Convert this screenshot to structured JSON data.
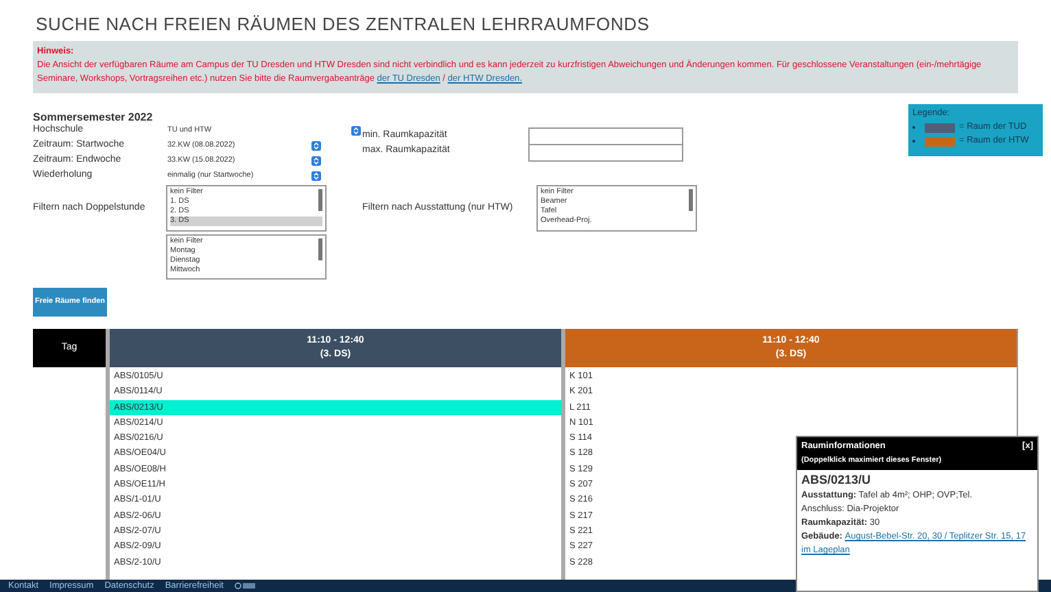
{
  "title": "SUCHE NACH FREIEN RÄUMEN DES ZENTRALEN LEHRRAUMFONDS",
  "notice": {
    "heading": "Hinweis:",
    "text": "Die Ansicht der verfügbaren Räume am Campus der TU Dresden und HTW Dresden sind nicht verbindlich und es kann jederzeit zu kurzfristigen Abweichungen und Änderungen kommen. Für geschlossene Veranstaltungen (ein-/mehrtägige Seminare, Workshops, Vortragsreihen etc.) nutzen Sie bitte die Raumvergabeanträge",
    "links": [
      "der TU Dresden",
      "der HTW Dresden."
    ],
    "separator": "/"
  },
  "semester": "Sommersemester 2022",
  "selects": [
    {
      "label": "Hochschule",
      "value": "TU und HTW"
    },
    {
      "label": "Zeitraum: Startwoche",
      "value": "32.KW (08.08.2022)"
    },
    {
      "label": "Zeitraum: Endwoche",
      "value": "33.KW (15.08.2022)"
    },
    {
      "label": "Wiederholung",
      "value": "einmalig (nur Startwoche)"
    }
  ],
  "capacity": [
    {
      "label": "min. Raumkapazität"
    },
    {
      "label": "max. Raumkapazität"
    }
  ],
  "legend": {
    "title": "Legende:",
    "items": [
      {
        "label": "= Raum der TUD",
        "color": "#4f5f78"
      },
      {
        "label": "= Raum der HTW",
        "color": "#c8651b"
      }
    ]
  },
  "filter_ds": {
    "label": "Filtern nach Doppelstunde",
    "options": [
      {
        "label": "kein Filter",
        "selected": false
      },
      {
        "label": "1. DS",
        "selected": false
      },
      {
        "label": "2. DS",
        "selected": false
      },
      {
        "label": "3. DS",
        "selected": true
      }
    ]
  },
  "filter_day": {
    "options": [
      {
        "label": "kein Filter",
        "selected": false
      },
      {
        "label": "Montag",
        "selected": false
      },
      {
        "label": "Dienstag",
        "selected": false
      },
      {
        "label": "Mittwoch",
        "selected": false
      }
    ]
  },
  "filter_equipment": {
    "label": "Filtern nach Ausstattung (nur HTW)",
    "options": [
      {
        "label": "kein Filter",
        "selected": false
      },
      {
        "label": "Beamer",
        "selected": false
      },
      {
        "label": "Tafel",
        "selected": false
      },
      {
        "label": "Overhead-Proj.",
        "selected": false
      }
    ]
  },
  "search_button": "Freie Räume finden",
  "table": {
    "day_header": "Tag",
    "columns": [
      {
        "time": "11:10 - 12:40",
        "slot": "(3. DS)",
        "color": "#3d4f63"
      },
      {
        "time": "11:10 - 12:40",
        "slot": "(3. DS)",
        "color": "#c8651b"
      }
    ],
    "tud_rooms": [
      {
        "name": "ABS/0105/U",
        "selected": false
      },
      {
        "name": "ABS/0114/U",
        "selected": false
      },
      {
        "name": "ABS/0213/U",
        "selected": true
      },
      {
        "name": "ABS/0214/U",
        "selected": false
      },
      {
        "name": "ABS/0216/U",
        "selected": false
      },
      {
        "name": "ABS/OE04/U",
        "selected": false
      },
      {
        "name": "ABS/OE08/H",
        "selected": false
      },
      {
        "name": "ABS/OE11/H",
        "selected": false
      },
      {
        "name": "ABS/1-01/U",
        "selected": false
      },
      {
        "name": "ABS/2-06/U",
        "selected": false
      },
      {
        "name": "ABS/2-07/U",
        "selected": false
      },
      {
        "name": "ABS/2-09/U",
        "selected": false
      },
      {
        "name": "ABS/2-10/U",
        "selected": false
      }
    ],
    "htw_rooms": [
      "K 101",
      "K 201",
      "L 211",
      "N 101",
      "S 114",
      "S 128",
      "S 129",
      "S 207",
      "S 216",
      "S 217",
      "S 221",
      "S 227",
      "S 228"
    ]
  },
  "popup": {
    "title": "Rauminformationen",
    "close": "[x]",
    "subtitle": "(Doppelklick maximiert dieses Fenster)",
    "room": "ABS/0213/U",
    "lines": [
      "**Ausstattung:** Tafel ab 4m²; OHP; OVP;Tel.",
      "Anschluss: Dia-Projektor",
      "**Raumkapazität:** 30"
    ],
    "building_label": "Gebäude:",
    "building_link": "August-Bebel-Str. 20, 30 / Teplitzer Str. 15, 17",
    "map_link": "im Lageplan"
  },
  "footer": [
    "Kontakt",
    "Impressum",
    "Datenschutz",
    "Barrierefreiheit"
  ]
}
